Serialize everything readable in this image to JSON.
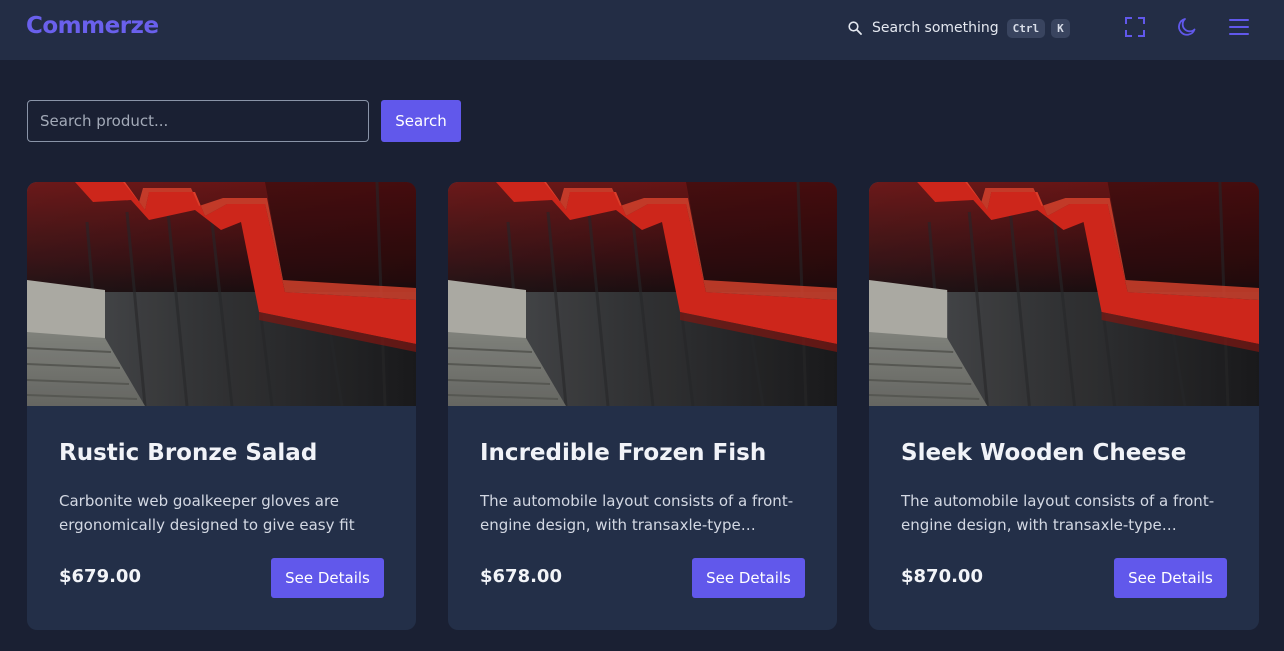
{
  "header": {
    "brand": "Commerze",
    "search_label": "Search something",
    "shortcut_keys": [
      "Ctrl",
      "K"
    ],
    "icons": [
      "search-icon",
      "fullscreen-icon",
      "moon-icon",
      "menu-icon"
    ],
    "accent_color": "#6158eb"
  },
  "search": {
    "placeholder": "Search product...",
    "value": "",
    "button_label": "Search"
  },
  "products": [
    {
      "title": "Rustic Bronze Salad",
      "description": "Carbonite web goalkeeper gloves are ergonomically designed to give easy fit",
      "price": "$679.00",
      "button_label": "See Details"
    },
    {
      "title": "Incredible Frozen Fish",
      "description": "The automobile layout consists of a front-engine design, with transaxle-type transmissions",
      "price": "$678.00",
      "button_label": "See Details"
    },
    {
      "title": "Sleek Wooden Cheese",
      "description": "The automobile layout consists of a front-engine design, with transaxle-type transmissions",
      "price": "$870.00",
      "button_label": "See Details"
    }
  ]
}
